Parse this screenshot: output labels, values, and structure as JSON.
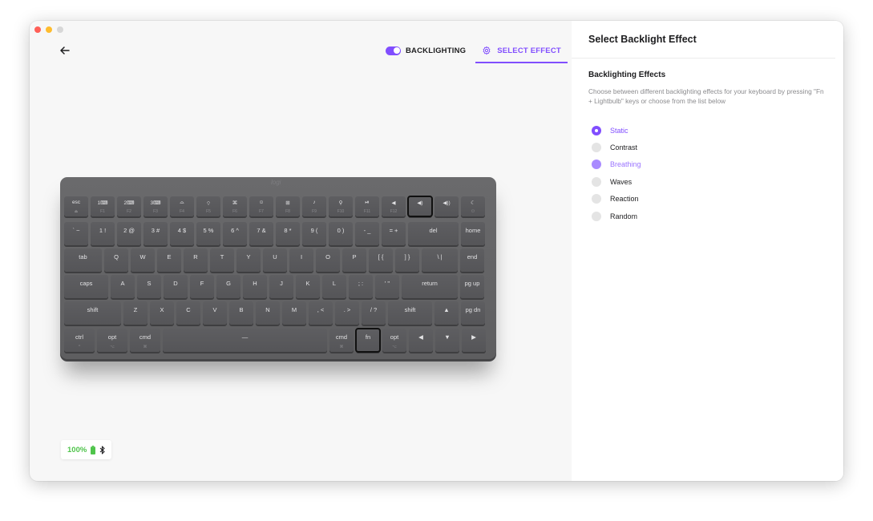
{
  "header": {
    "backlighting_label": "BACKLIGHTING",
    "select_effect_label": "SELECT EFFECT"
  },
  "colors": {
    "accent": "#814eff",
    "battery": "#4fc44b"
  },
  "icons": {
    "back": "arrow-left-icon",
    "settings": "gear-icon",
    "battery": "battery-icon",
    "bluetooth": "bluetooth-icon"
  },
  "keyboard": {
    "logo": "logi",
    "rows": [
      [
        {
          "main": "esc",
          "sub": "⏏",
          "w": 30,
          "f": 1
        },
        {
          "main": "1⌨",
          "sub": "F1",
          "w": 30,
          "f": 1
        },
        {
          "main": "2⌨",
          "sub": "F2",
          "w": 30,
          "f": 1
        },
        {
          "main": "3⌨",
          "sub": "F3",
          "w": 30,
          "f": 1
        },
        {
          "main": "⌓",
          "sub": "F4",
          "w": 30,
          "f": 1
        },
        {
          "main": "⌔",
          "sub": "F5",
          "w": 30,
          "f": 1
        },
        {
          "main": "⌘",
          "sub": "F6",
          "w": 30,
          "f": 1
        },
        {
          "main": "☺",
          "sub": "F7",
          "w": 30,
          "f": 1
        },
        {
          "main": "⊞",
          "sub": "F8",
          "w": 30,
          "f": 1
        },
        {
          "main": "♪",
          "sub": "F9",
          "w": 30,
          "f": 1
        },
        {
          "main": "⚲",
          "sub": "F10",
          "w": 30,
          "f": 1
        },
        {
          "main": "⏯",
          "sub": "F11",
          "w": 30,
          "f": 1
        },
        {
          "main": "◀",
          "sub": "F12",
          "w": 30,
          "f": 1
        },
        {
          "main": "◀)",
          "sub": "",
          "w": 30,
          "f": 1,
          "hl": 1
        },
        {
          "main": "◀))",
          "sub": "",
          "w": 30,
          "f": 1
        },
        {
          "main": "☾",
          "sub": "⏻",
          "w": 30,
          "f": 1
        }
      ],
      [
        {
          "main": "` ~",
          "w": 30
        },
        {
          "main": "1 !",
          "w": 30
        },
        {
          "main": "2 @",
          "w": 30
        },
        {
          "main": "3 #",
          "w": 30
        },
        {
          "main": "4 $",
          "w": 30
        },
        {
          "main": "5 %",
          "w": 30
        },
        {
          "main": "6 ^",
          "w": 30
        },
        {
          "main": "7 &",
          "w": 30
        },
        {
          "main": "8 *",
          "w": 30
        },
        {
          "main": "9 (",
          "w": 30
        },
        {
          "main": "0 )",
          "w": 30
        },
        {
          "main": "- _",
          "w": 30
        },
        {
          "main": "= +",
          "w": 30
        },
        {
          "main": "del",
          "w": 63
        },
        {
          "main": "home",
          "w": 30
        }
      ],
      [
        {
          "main": "tab",
          "w": 47
        },
        {
          "main": "Q",
          "w": 30
        },
        {
          "main": "W",
          "w": 30
        },
        {
          "main": "E",
          "w": 30
        },
        {
          "main": "R",
          "w": 30
        },
        {
          "main": "T",
          "w": 30
        },
        {
          "main": "Y",
          "w": 30
        },
        {
          "main": "U",
          "w": 30
        },
        {
          "main": "I",
          "w": 30
        },
        {
          "main": "O",
          "w": 30
        },
        {
          "main": "P",
          "w": 30
        },
        {
          "main": "[ {",
          "w": 30
        },
        {
          "main": "] }",
          "w": 30
        },
        {
          "main": "\\ |",
          "w": 45
        },
        {
          "main": "end",
          "w": 30
        }
      ],
      [
        {
          "main": "caps",
          "w": 55
        },
        {
          "main": "A",
          "w": 30
        },
        {
          "main": "S",
          "w": 30
        },
        {
          "main": "D",
          "w": 30
        },
        {
          "main": "F",
          "w": 30
        },
        {
          "main": "G",
          "w": 30
        },
        {
          "main": "H",
          "w": 30
        },
        {
          "main": "J",
          "w": 30
        },
        {
          "main": "K",
          "w": 30
        },
        {
          "main": "L",
          "w": 30
        },
        {
          "main": "; :",
          "w": 30
        },
        {
          "main": "' \"",
          "w": 30
        },
        {
          "main": "return",
          "w": 70
        },
        {
          "main": "pg up",
          "w": 30
        }
      ],
      [
        {
          "main": "shift",
          "w": 71
        },
        {
          "main": "Z",
          "w": 30
        },
        {
          "main": "X",
          "w": 30
        },
        {
          "main": "C",
          "w": 30
        },
        {
          "main": "V",
          "w": 30
        },
        {
          "main": "B",
          "w": 30
        },
        {
          "main": "N",
          "w": 30
        },
        {
          "main": "M",
          "w": 30
        },
        {
          "main": ", <",
          "w": 30
        },
        {
          "main": ". >",
          "w": 30
        },
        {
          "main": "/ ?",
          "w": 30
        },
        {
          "main": "shift",
          "w": 55
        },
        {
          "main": "▲",
          "w": 30
        },
        {
          "main": "pg dn",
          "w": 30
        }
      ],
      [
        {
          "main": "ctrl",
          "sub": "^",
          "w": 38
        },
        {
          "main": "opt",
          "sub": "⌥",
          "w": 38
        },
        {
          "main": "cmd",
          "sub": "⌘",
          "w": 38
        },
        {
          "main": "—",
          "w": 205
        },
        {
          "main": "cmd",
          "sub": "⌘",
          "w": 30
        },
        {
          "main": "fn",
          "w": 30,
          "hl": 1
        },
        {
          "main": "opt",
          "sub": "⌥",
          "w": 30
        },
        {
          "main": "◀",
          "w": 30
        },
        {
          "main": "▼",
          "w": 30
        },
        {
          "main": "▶",
          "w": 30
        }
      ]
    ]
  },
  "battery": {
    "percent": "100%"
  },
  "panel": {
    "title": "Select Backlight Effect",
    "section_title": "Backlighting Effects",
    "description": "Choose between different backlighting effects for your keyboard by pressing \"Fn + Lightbulb\" keys or choose from the list below",
    "effects": [
      {
        "label": "Static",
        "state": "selected"
      },
      {
        "label": "Contrast",
        "state": "off"
      },
      {
        "label": "Breathing",
        "state": "active"
      },
      {
        "label": "Waves",
        "state": "off"
      },
      {
        "label": "Reaction",
        "state": "off"
      },
      {
        "label": "Random",
        "state": "off"
      }
    ]
  }
}
